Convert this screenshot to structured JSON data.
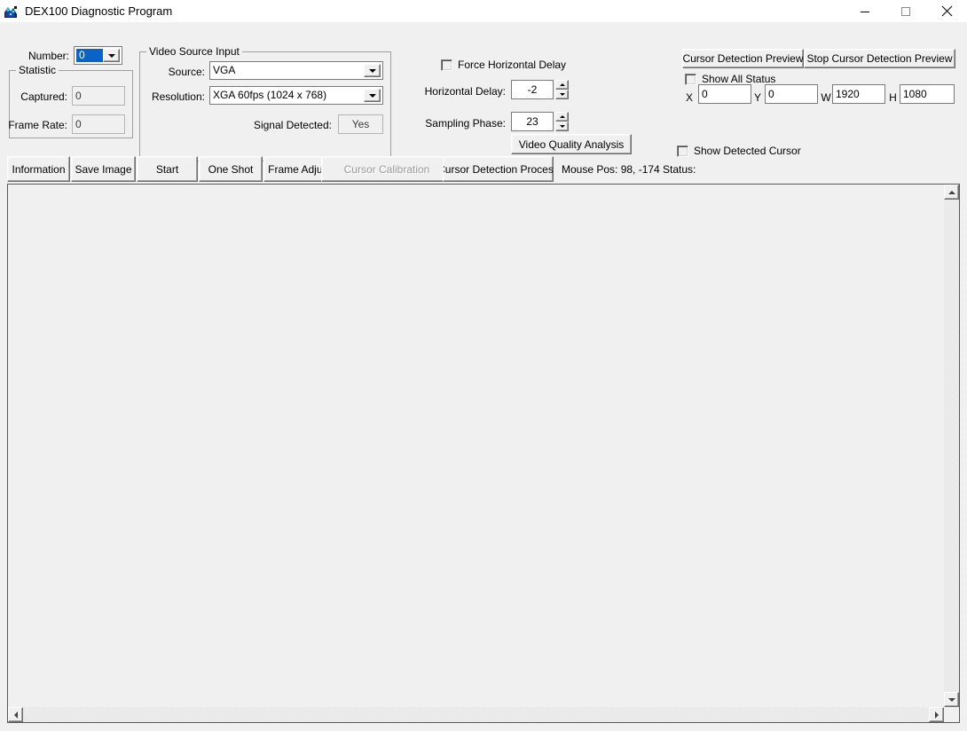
{
  "window": {
    "title": "DEX100 Diagnostic Program",
    "icon": "app-icon",
    "minimize_label": "minimize-icon",
    "maximize_label": "maximize-icon",
    "close_label": "close-icon"
  },
  "left_panel": {
    "number_label": "Number:",
    "number_value": "0",
    "statistic_group_title": "Statistic",
    "captured_label": "Captured:",
    "captured_value": "0",
    "frame_rate_label": "Frame Rate:",
    "frame_rate_value": "0"
  },
  "video_source": {
    "group_title": "Video Source Input",
    "source_label": "Source:",
    "source_value": "VGA",
    "resolution_label": "Resolution:",
    "resolution_value": "XGA 60fps (1024 x 768)",
    "signal_detected_label": "Signal Detected:",
    "signal_detected_value": "Yes"
  },
  "timing": {
    "force_horizontal_delay_label": "Force Horizontal Delay",
    "force_horizontal_delay_checked": false,
    "horizontal_delay_label": "Horizontal Delay:",
    "horizontal_delay_value": "-2",
    "sampling_phase_label": "Sampling Phase:",
    "sampling_phase_value": "23",
    "video_quality_analysis_label": "Video Quality Analysis"
  },
  "cursor_panel": {
    "preview_button_label": "Cursor Detection Preview",
    "stop_preview_button_label": "Stop Cursor Detection Preview",
    "show_all_status_label": "Show All Status",
    "show_all_status_checked": false,
    "x_label": "X",
    "x_value": "0",
    "y_label": "Y",
    "y_value": "0",
    "w_label": "W",
    "w_value": "1920",
    "h_label": "H",
    "h_value": "1080",
    "show_detected_cursor_label": "Show Detected Cursor",
    "show_detected_cursor_checked": false
  },
  "toolbar": {
    "information_label": "Information",
    "save_image_label": "Save Image",
    "start_label": "Start",
    "one_shot_label": "One Shot",
    "frame_adjust_label": "Frame Adjust",
    "cursor_calibration_label": "Cursor Calibration",
    "cursor_calibration_disabled": true,
    "cursor_detection_process_label": "Cursor Detection Process",
    "mouse_pos_label": "Mouse Pos: 98, -174",
    "status_label": "Status:"
  },
  "colors": {
    "face": "#f0f0f0",
    "selection_blue": "#0a64c8",
    "border": "#7a7a7a",
    "disabled_text": "#9a9a9a"
  }
}
